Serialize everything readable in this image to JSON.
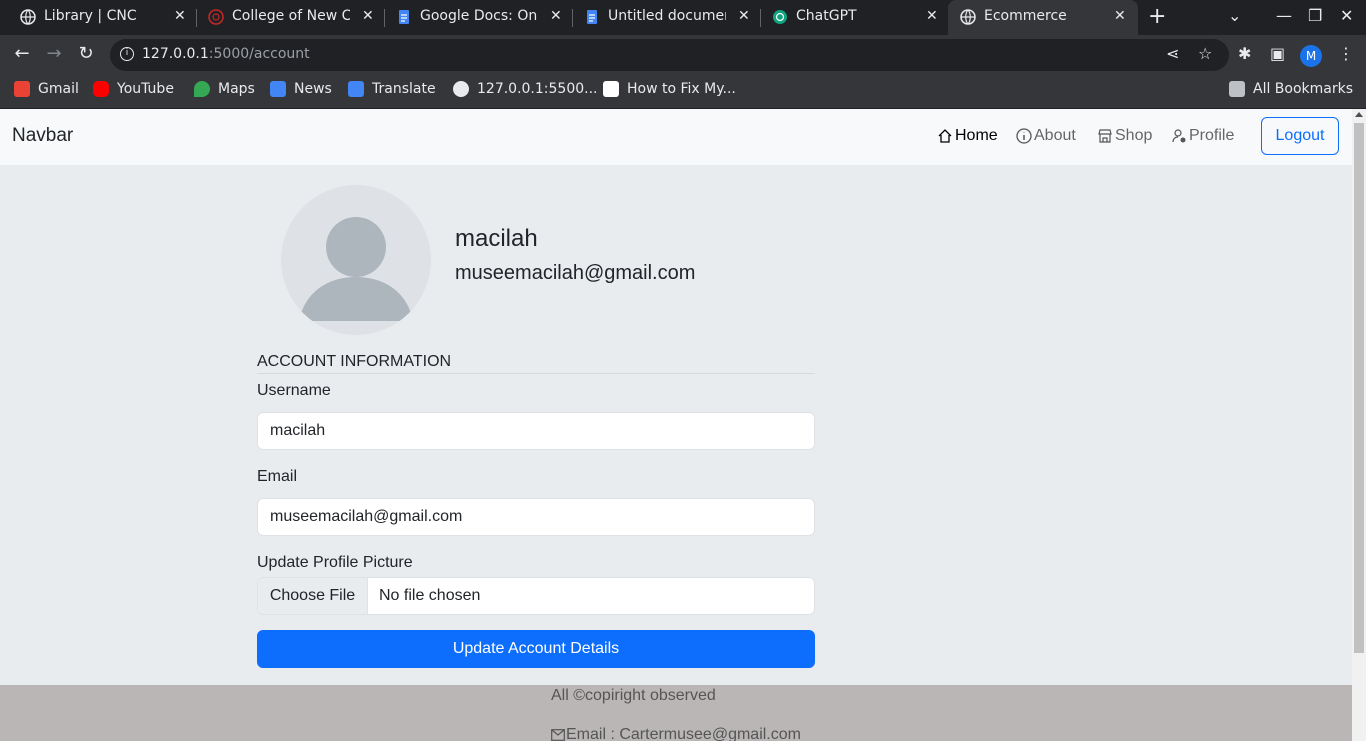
{
  "browser": {
    "tabs": [
      {
        "title": "Library | CNC",
        "icon": "globe-icon",
        "active": false
      },
      {
        "title": "College of New Ca",
        "icon": "college-icon",
        "active": false
      },
      {
        "title": "Google Docs: Onl",
        "icon": "docs-icon",
        "active": false
      },
      {
        "title": "Untitled documen",
        "icon": "docs-icon",
        "active": false
      },
      {
        "title": "ChatGPT",
        "icon": "chatgpt-icon",
        "active": false
      },
      {
        "title": "Ecommerce",
        "icon": "globe-icon",
        "active": true
      }
    ],
    "url_host": "127.0.0.1",
    "url_path": ":5000/account",
    "profile_initial": "M",
    "bookmarks": [
      {
        "label": "Gmail",
        "icon": "gmail-icon",
        "color": "#ea4335"
      },
      {
        "label": "YouTube",
        "icon": "youtube-icon",
        "color": "#ff0000"
      },
      {
        "label": "Maps",
        "icon": "maps-icon",
        "color": "#34a853"
      },
      {
        "label": "News",
        "icon": "news-icon",
        "color": "#4285f4"
      },
      {
        "label": "Translate",
        "icon": "translate-icon",
        "color": "#4285f4"
      },
      {
        "label": "127.0.0.1:5500...",
        "icon": "globe-icon",
        "color": "#e8eaed"
      },
      {
        "label": "How to Fix My...",
        "icon": "page-icon",
        "color": "#ffffff"
      }
    ],
    "all_bookmarks": "All Bookmarks"
  },
  "navbar": {
    "brand": "Navbar",
    "links": [
      {
        "label": "Home",
        "icon": "house-icon",
        "active": true
      },
      {
        "label": "About",
        "icon": "info-circle-icon",
        "active": false
      },
      {
        "label": "Shop",
        "icon": "shop-icon",
        "active": false
      },
      {
        "label": "Profile",
        "icon": "person-gear-icon",
        "active": false
      }
    ],
    "logout": "Logout"
  },
  "profile": {
    "username": "macilah",
    "email": "museemacilah@gmail.com"
  },
  "form": {
    "section_title": "ACCOUNT INFORMATION",
    "username_label": "Username",
    "username_value": "macilah",
    "email_label": "Email",
    "email_value": "museemacilah@gmail.com",
    "picture_label": "Update Profile Picture",
    "file_button": "Choose File",
    "file_status": "No file chosen",
    "submit": "Update Account Details"
  },
  "footer": {
    "copyright": "All ©copiright observed",
    "email": "Email : Cartermusee@gmail.com"
  },
  "colors": {
    "primary": "#0d6efd",
    "page_bg": "#e9ecef",
    "footer_bg": "#bab6b6"
  }
}
